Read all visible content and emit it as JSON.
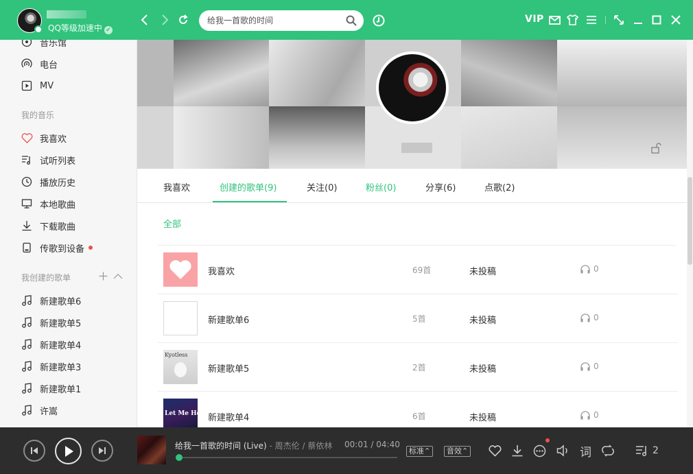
{
  "window": {
    "vip_level": "QQ等级加速中",
    "search_placeholder": "给我一首歌的时间",
    "vip_label": "VIP"
  },
  "sidebar": {
    "top_items": [
      {
        "label": "音乐馆",
        "icon": "music-hall-icon"
      },
      {
        "label": "电台",
        "icon": "radio-icon"
      },
      {
        "label": "MV",
        "icon": "mv-icon"
      }
    ],
    "my_music_header": "我的音乐",
    "my_music_items": [
      {
        "label": "我喜欢",
        "icon": "heart-icon"
      },
      {
        "label": "试听列表",
        "icon": "trial-list-icon"
      },
      {
        "label": "播放历史",
        "icon": "history-clock-icon"
      },
      {
        "label": "本地歌曲",
        "icon": "monitor-icon"
      },
      {
        "label": "下载歌曲",
        "icon": "download-icon"
      },
      {
        "label": "传歌到设备",
        "icon": "device-icon"
      }
    ],
    "created_header": "我创建的歌单",
    "created_items": [
      {
        "label": "新建歌单6"
      },
      {
        "label": "新建歌单5"
      },
      {
        "label": "新建歌单4"
      },
      {
        "label": "新建歌单3"
      },
      {
        "label": "新建歌单1"
      },
      {
        "label": "许嵩"
      }
    ]
  },
  "tabs": [
    {
      "label": "我喜欢"
    },
    {
      "label": "创建的歌单(9)"
    },
    {
      "label": "关注(0)"
    },
    {
      "label": "粉丝(0)"
    },
    {
      "label": "分享(6)"
    },
    {
      "label": "点歌(2)"
    }
  ],
  "filter": {
    "all": "全部"
  },
  "playlists": [
    {
      "name": "我喜欢",
      "count": "69首",
      "status": "未投稿",
      "listens": "0",
      "cover": "heart"
    },
    {
      "name": "新建歌单6",
      "count": "5首",
      "status": "未投稿",
      "listens": "0",
      "cover": "empty"
    },
    {
      "name": "新建歌单5",
      "count": "2首",
      "status": "未投稿",
      "listens": "0",
      "cover": "album-light"
    },
    {
      "name": "新建歌单4",
      "count": "6首",
      "status": "未投稿",
      "listens": "0",
      "cover": "album-dark"
    }
  ],
  "album_text": {
    "cover3": "Kyotless",
    "cover4": "Let Me Hear"
  },
  "player": {
    "song": "给我一首歌的时间 (Live)",
    "artist": " - 周杰伦 / 蔡依林",
    "current_time": "00:01",
    "time_sep": " / ",
    "total_time": "04:40",
    "progress": 0.004,
    "quality": "标准",
    "effect": "音效",
    "lyric": "词",
    "queue_count": "2"
  },
  "colors": {
    "accent": "#31c27c",
    "player_bg": "#2d2d2d",
    "sidebar_bg": "#f6f6f6"
  }
}
